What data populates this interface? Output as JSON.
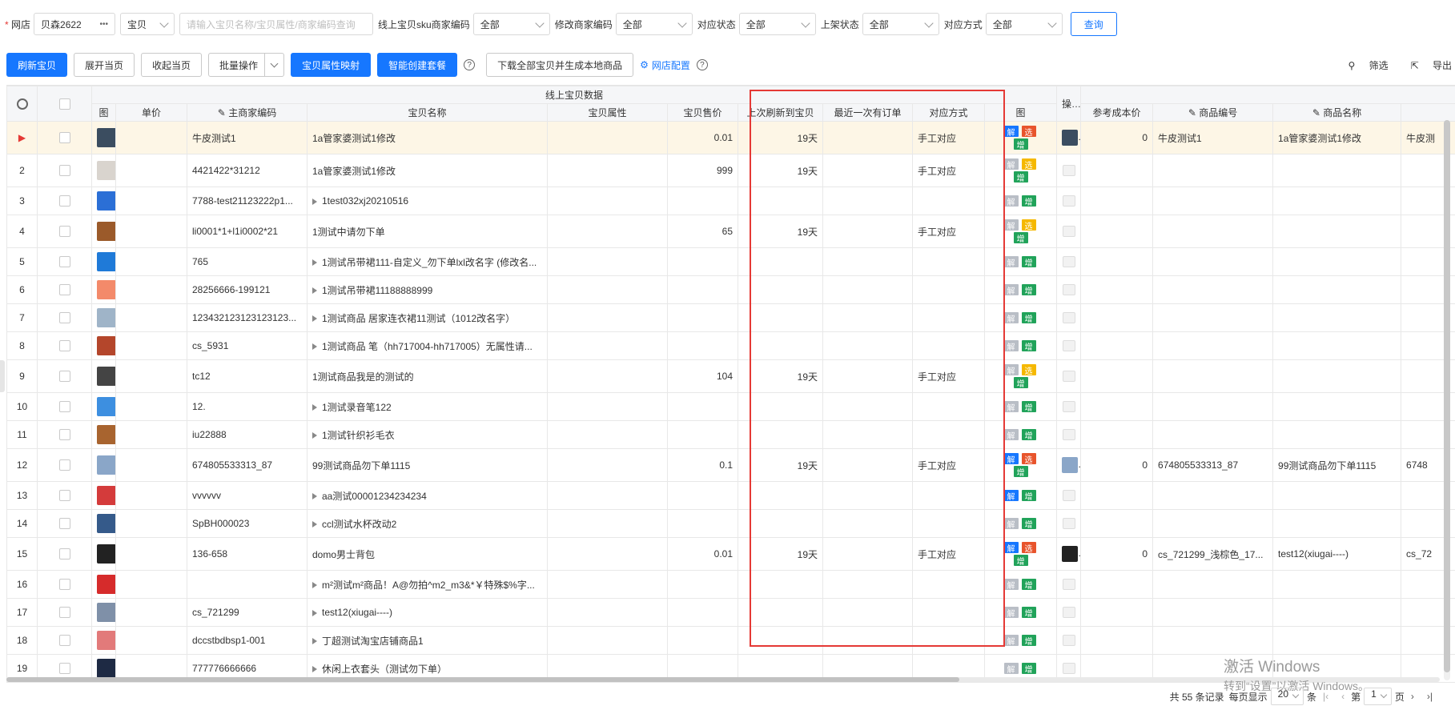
{
  "filters": {
    "shop_label": "网店",
    "shop_value": "贝森2622",
    "shop_more": "•••",
    "type_value": "宝贝",
    "search_placeholder": "请输入宝贝名称/宝贝属性/商家编码查询",
    "sku_label": "线上宝贝sku商家编码",
    "sku_value": "全部",
    "modify_label": "修改商家编码",
    "modify_value": "全部",
    "match_status_label": "对应状态",
    "match_status_value": "全部",
    "listing_label": "上架状态",
    "listing_value": "全部",
    "match_mode_label": "对应方式",
    "match_mode_value": "全部",
    "query_btn": "查询"
  },
  "toolbar": {
    "refresh": "刷新宝贝",
    "expand": "展开当页",
    "collapse": "收起当页",
    "batch": "批量操作",
    "attr_map": "宝贝属性映射",
    "smart_create": "智能创建套餐",
    "download": "下载全部宝贝并生成本地商品",
    "shop_config": "网店配置",
    "filter": "筛选",
    "export": "导出"
  },
  "table": {
    "group_header": "线上宝贝数据",
    "ops_header": "操作列",
    "headers": {
      "img": "图",
      "price": "单价",
      "code": "主商家编码",
      "name": "宝贝名称",
      "attr": "宝贝属性",
      "sale": "宝贝售价",
      "last_refresh": "上次刷新到宝贝",
      "last_order": "最近一次有订单",
      "match_mode": "对应方式",
      "img2": "图",
      "cost": "参考成本价",
      "goods_no": "商品编号",
      "goods_name": "商品名称"
    },
    "op_labels": {
      "jie": "解",
      "xuan": "选",
      "zeng": "增"
    },
    "rows": [
      {
        "no": "",
        "code": "牛皮测试1",
        "name": "1a管家婆测试1修改",
        "sale": "0.01",
        "last": "19天",
        "mode": "手工对应",
        "cost": "0",
        "goods_no": "牛皮测试1",
        "goods_name": "1a管家婆测试1修改",
        "extra": "牛皮测"
      },
      {
        "no": "2",
        "code": "4421422*31212",
        "name": "1a管家婆测试1修改",
        "sale": "999",
        "last": "19天",
        "mode": "手工对应"
      },
      {
        "no": "3",
        "code": "7788-test21123222p1...",
        "name": "1test032xj20210516"
      },
      {
        "no": "4",
        "code": "li0001*1+l1i0002*21",
        "name": "1测试中请勿下单",
        "sale": "65",
        "last": "19天",
        "mode": "手工对应"
      },
      {
        "no": "5",
        "code": "765",
        "name": "1测试吊带裙111-自定义_勿下单lxl改名字 (修改名..."
      },
      {
        "no": "6",
        "code": "28256666-199121",
        "name": "1测试吊带裙11188888999"
      },
      {
        "no": "7",
        "code": "1234321231231231​23...",
        "name": "1测试商品 居家连衣裙11测试（1012改名字）"
      },
      {
        "no": "8",
        "code": "cs_5931",
        "name": "1测试商品 笔（hh717004-hh717005）无属性请..."
      },
      {
        "no": "9",
        "code": "tc12",
        "name": "1测试商品我是的测试的",
        "sale": "104",
        "last": "19天",
        "mode": "手工对应"
      },
      {
        "no": "10",
        "code": "12.",
        "name": "1测试录音笔122"
      },
      {
        "no": "11",
        "code": "iu22888",
        "name": "1测试针织衫毛衣"
      },
      {
        "no": "12",
        "code": "674805533313_87",
        "name": "99测试商品勿下单1115",
        "sale": "0.1",
        "last": "19天",
        "mode": "手工对应",
        "cost": "0",
        "goods_no": "674805533313_87",
        "goods_name": "99测试商品勿下单1115",
        "extra": "6748"
      },
      {
        "no": "13",
        "code": "vvvvvv",
        "name": "aa测试00001234234234"
      },
      {
        "no": "14",
        "code": "SpBH000023",
        "name": "ccl测试水杯改动2"
      },
      {
        "no": "15",
        "code": "136-658",
        "name": "domo男士背包",
        "sale": "0.01",
        "last": "19天",
        "mode": "手工对应",
        "cost": "0",
        "goods_no": "cs_721299_浅棕色_17...",
        "goods_name": "test12(xiugai----)",
        "extra": "cs_72"
      },
      {
        "no": "16",
        "code": "",
        "name": "m²测试m²商品！A@勿拍^m2_m3&*￥特殊$%字..."
      },
      {
        "no": "17",
        "code": "cs_721299",
        "name": "test12(xiugai----)"
      },
      {
        "no": "18",
        "code": "dccstbdbsp1-001",
        "name": "丁超测试淘宝店铺商品1"
      },
      {
        "no": "19",
        "code": "777776666666",
        "name": "休闲上衣套头（测试勿下单）"
      }
    ]
  },
  "pager": {
    "total": "共 55 条记录",
    "per_page_label": "每页显示",
    "per_page": "20",
    "unit": "条",
    "page_prefix": "第",
    "page": "1",
    "page_suffix": "页"
  },
  "watermark": {
    "line1": "激活 Windows",
    "line2": "转到“设置”以激活 Windows。"
  },
  "colors": {
    "primary": "#1677ff",
    "highlight_box": "#e53935",
    "op_jie": "#1677ff",
    "op_xuan": "#e8542c",
    "op_xuan_alt": "#f5b800",
    "op_zeng": "#21a35a"
  }
}
